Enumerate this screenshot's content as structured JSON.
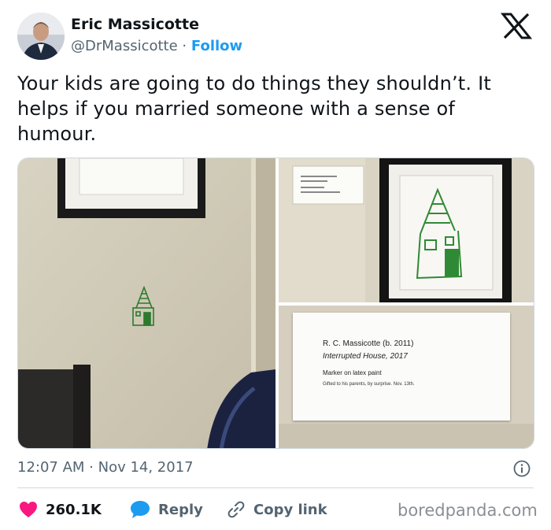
{
  "author": {
    "name": "Eric Massicotte",
    "handle": "@DrMassicotte",
    "separator": "·",
    "follow_label": "Follow"
  },
  "tweet": {
    "text": "Your kids are going to do things they shouldn’t. It helps if you married someone with a sense of humour.",
    "timestamp": "12:07 AM · Nov 14, 2017"
  },
  "placard": {
    "line1": "R. C. Massicotte (b. 2011)",
    "line2": "Interrupted House, 2017",
    "line3": "Marker on latex paint",
    "line4": "Gifted to his parents, by surprise. Nov. 13th."
  },
  "actions": {
    "like_count": "260.1K",
    "reply_label": "Reply",
    "copy_label": "Copy link"
  },
  "watermark": "boredpanda.com",
  "icons": {
    "logo": "x-logo-icon",
    "info": "info-icon",
    "like": "heart-icon",
    "reply": "speech-bubble-icon",
    "copy": "link-icon"
  },
  "colors": {
    "accent": "#1d9bf0",
    "heart": "#f91880",
    "text": "#0f1419",
    "muted": "#536471"
  }
}
